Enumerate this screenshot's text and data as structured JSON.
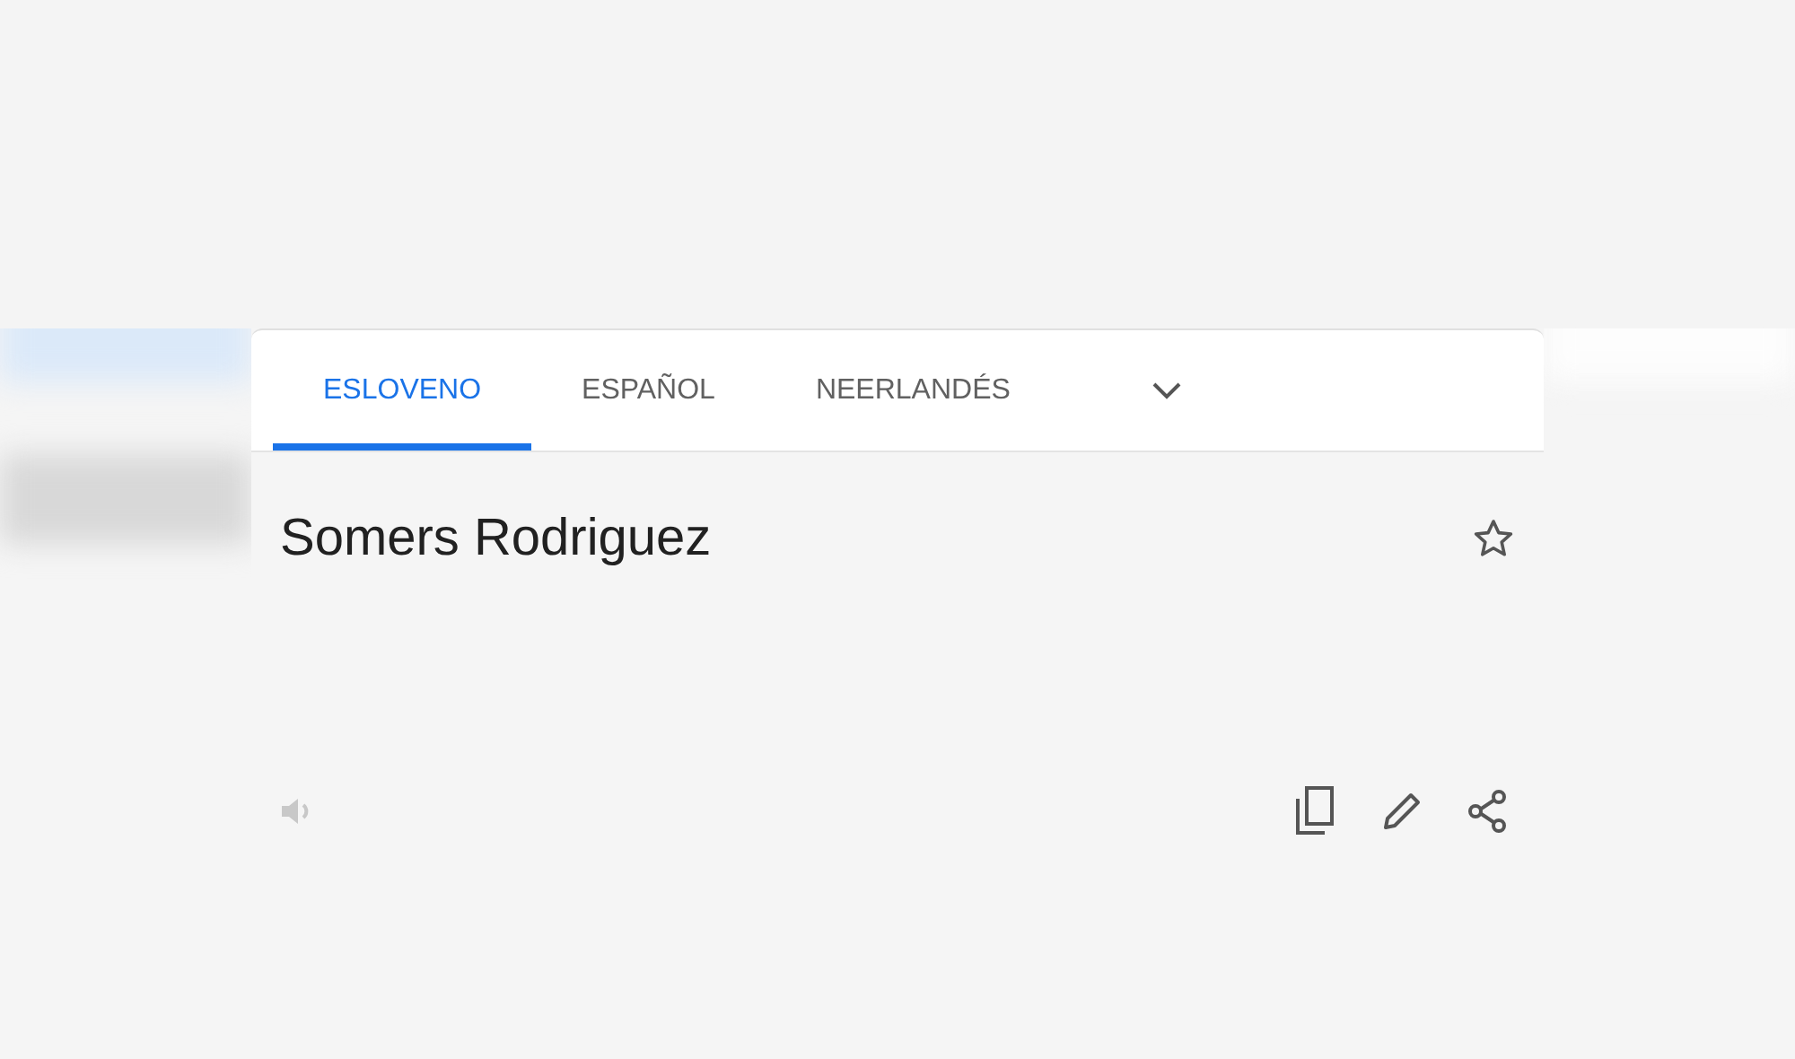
{
  "tabs": [
    {
      "label": "ESLOVENO",
      "selected": true
    },
    {
      "label": "ESPAÑOL",
      "selected": false
    },
    {
      "label": "NEERLANDÉS",
      "selected": false
    }
  ],
  "translation": {
    "text": "Somers Rodriguez",
    "starred": false
  },
  "speaker": {
    "disabled": true
  }
}
